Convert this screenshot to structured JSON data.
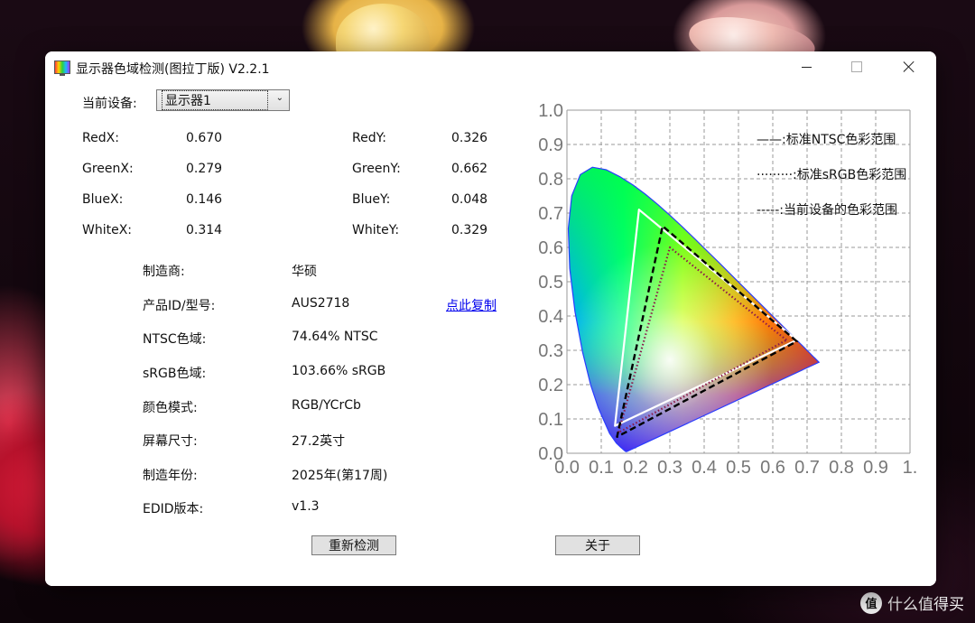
{
  "window": {
    "title": "显示器色域检测(图拉丁版) V2.2.1"
  },
  "device": {
    "label": "当前设备:",
    "selected": "显示器1"
  },
  "coords": [
    {
      "label": "RedX:",
      "value": "0.670"
    },
    {
      "label": "RedY:",
      "value": "0.326"
    },
    {
      "label": "GreenX:",
      "value": "0.279"
    },
    {
      "label": "GreenY:",
      "value": "0.662"
    },
    {
      "label": "BlueX:",
      "value": "0.146"
    },
    {
      "label": "BlueY:",
      "value": "0.048"
    },
    {
      "label": "WhiteX:",
      "value": "0.314"
    },
    {
      "label": "WhiteY:",
      "value": "0.329"
    }
  ],
  "info": [
    {
      "label": "制造商:",
      "value": "华硕"
    },
    {
      "label": "产品ID/型号:",
      "value": "AUS2718"
    },
    {
      "label": "NTSC色域:",
      "value": "74.64% NTSC"
    },
    {
      "label": "sRGB色域:",
      "value": "103.66% sRGB"
    },
    {
      "label": "颜色模式:",
      "value": "RGB/YCrCb"
    },
    {
      "label": "屏幕尺寸:",
      "value": "27.2英寸"
    },
    {
      "label": "制造年份:",
      "value": "2025年(第17周)"
    },
    {
      "label": "EDID版本:",
      "value": "v1.3"
    }
  ],
  "copy_link": "点此复制",
  "buttons": {
    "recheck": "重新检测",
    "about": "关于"
  },
  "watermark": {
    "logo": "值",
    "text": "什么值得买"
  },
  "colors": {
    "link": "#0000ee",
    "ntsc_line": "#ffffff",
    "srgb_line": "#8b1a4a",
    "device_line": "#000000"
  },
  "chart_data": {
    "type": "scatter",
    "title": "",
    "xlabel": "",
    "ylabel": "",
    "xlim": [
      0,
      1
    ],
    "ylim": [
      0,
      1
    ],
    "grid": true,
    "x_ticks": [
      "0.0",
      "0.1",
      "0.2",
      "0.3",
      "0.4",
      "0.5",
      "0.6",
      "0.7",
      "0.8",
      "0.9",
      "1."
    ],
    "y_ticks": [
      "0.0",
      "0.1",
      "0.2",
      "0.3",
      "0.4",
      "0.5",
      "0.6",
      "0.7",
      "0.8",
      "0.9",
      "1.0"
    ],
    "legend_position": "top-right",
    "legend": [
      {
        "name": "——:标准NTSC色彩范围",
        "style": "solid"
      },
      {
        "name": "·········:标准sRGB色彩范围",
        "style": "dotted"
      },
      {
        "name": "-----:当前设备的色彩范围",
        "style": "dashed"
      }
    ],
    "series": [
      {
        "name": "标准NTSC色彩范围",
        "points": [
          [
            0.67,
            0.33
          ],
          [
            0.21,
            0.71
          ],
          [
            0.14,
            0.08
          ]
        ]
      },
      {
        "name": "标准sRGB色彩范围",
        "points": [
          [
            0.64,
            0.33
          ],
          [
            0.3,
            0.6
          ],
          [
            0.15,
            0.06
          ]
        ]
      },
      {
        "name": "当前设备的色彩范围",
        "points": [
          [
            0.67,
            0.326
          ],
          [
            0.279,
            0.662
          ],
          [
            0.146,
            0.048
          ]
        ]
      }
    ],
    "locus": [
      [
        0.1741,
        0.005
      ],
      [
        0.1738,
        0.0049
      ],
      [
        0.1736,
        0.0049
      ],
      [
        0.1733,
        0.0048
      ],
      [
        0.1726,
        0.0048
      ],
      [
        0.1714,
        0.0051
      ],
      [
        0.1689,
        0.0069
      ],
      [
        0.1644,
        0.0109
      ],
      [
        0.1566,
        0.0177
      ],
      [
        0.144,
        0.0297
      ],
      [
        0.1241,
        0.0578
      ],
      [
        0.0913,
        0.1327
      ],
      [
        0.0687,
        0.2007
      ],
      [
        0.0454,
        0.295
      ],
      [
        0.0235,
        0.4127
      ],
      [
        0.0082,
        0.5384
      ],
      [
        0.0039,
        0.6548
      ],
      [
        0.0139,
        0.7502
      ],
      [
        0.0389,
        0.812
      ],
      [
        0.0743,
        0.8338
      ],
      [
        0.1142,
        0.8262
      ],
      [
        0.1547,
        0.8059
      ],
      [
        0.1929,
        0.7816
      ],
      [
        0.2296,
        0.7543
      ],
      [
        0.2658,
        0.7243
      ],
      [
        0.3016,
        0.6923
      ],
      [
        0.3373,
        0.6589
      ],
      [
        0.3731,
        0.6245
      ],
      [
        0.4087,
        0.5896
      ],
      [
        0.4441,
        0.5547
      ],
      [
        0.4788,
        0.5202
      ],
      [
        0.5125,
        0.4866
      ],
      [
        0.5448,
        0.4544
      ],
      [
        0.5752,
        0.4242
      ],
      [
        0.6029,
        0.3965
      ],
      [
        0.627,
        0.3725
      ],
      [
        0.6482,
        0.3514
      ],
      [
        0.6658,
        0.334
      ],
      [
        0.6801,
        0.3197
      ],
      [
        0.6915,
        0.3083
      ],
      [
        0.7006,
        0.2993
      ],
      [
        0.7079,
        0.292
      ],
      [
        0.714,
        0.2859
      ],
      [
        0.719,
        0.2809
      ],
      [
        0.723,
        0.277
      ],
      [
        0.726,
        0.274
      ],
      [
        0.7283,
        0.2717
      ],
      [
        0.73,
        0.27
      ],
      [
        0.7311,
        0.2689
      ],
      [
        0.732,
        0.268
      ],
      [
        0.7347,
        0.2653
      ]
    ]
  }
}
